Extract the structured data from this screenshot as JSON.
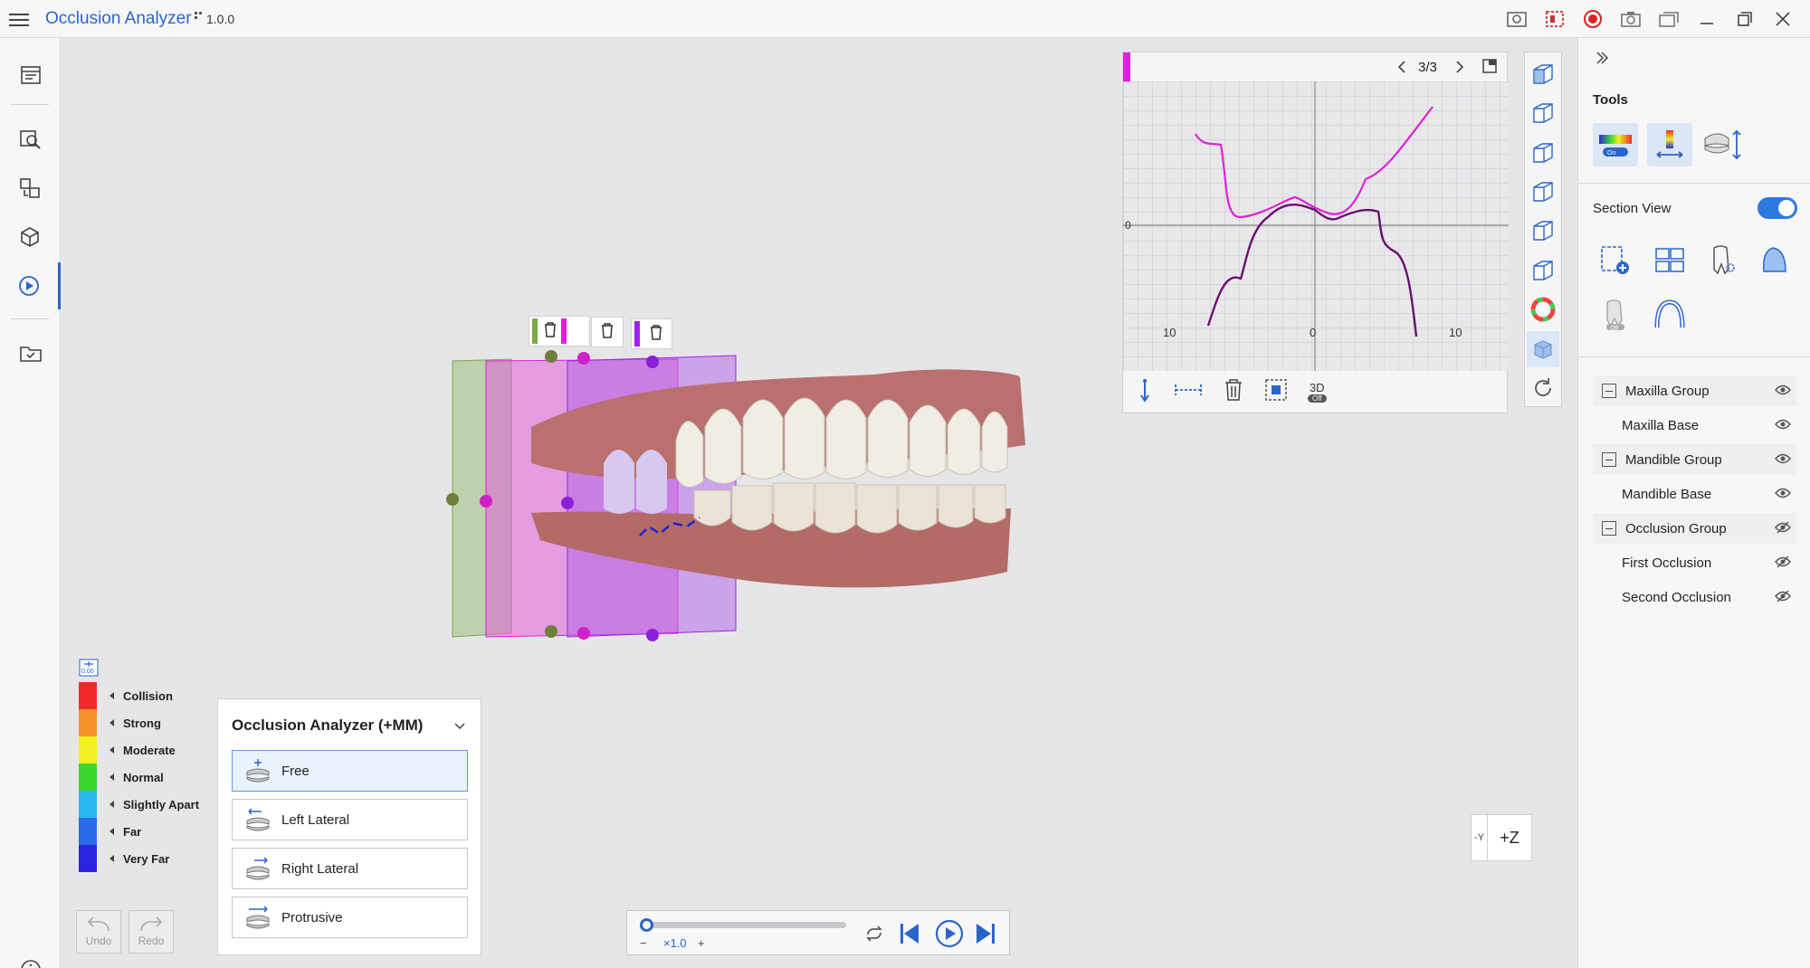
{
  "app": {
    "title": "Occlusion Analyzer",
    "version": "1.0.0"
  },
  "window_controls": [
    "capture-icon",
    "crop-record-icon",
    "record-icon",
    "camera-icon",
    "screens-icon",
    "minimize-icon",
    "restore-icon",
    "close-icon"
  ],
  "left_nav": [
    "report-icon",
    "inspect-icon",
    "align-icon",
    "model-icon",
    "play-icon",
    "checklist-icon"
  ],
  "graph": {
    "page": "3/3",
    "tick_left": "10",
    "tick_center": "0",
    "tick_right": "10",
    "zero_label": "0",
    "toggle_3d": "3D",
    "toggle_3d_state": "Off",
    "marker_color": "#e020d8"
  },
  "right_panel": {
    "tools_title": "Tools",
    "section_view_title": "Section View",
    "section_view_on": true,
    "tool_on_label": "On",
    "section_off_label": "Off",
    "tree": [
      {
        "label": "Maxilla Group",
        "group": true,
        "visible": true
      },
      {
        "label": "Maxilla Base",
        "group": false,
        "visible": true
      },
      {
        "label": "Mandible Group",
        "group": true,
        "visible": true
      },
      {
        "label": "Mandible Base",
        "group": false,
        "visible": true
      },
      {
        "label": "Occlusion Group",
        "group": true,
        "visible": false
      },
      {
        "label": "First Occlusion",
        "group": false,
        "visible": false
      },
      {
        "label": "Second Occlusion",
        "group": false,
        "visible": false
      }
    ]
  },
  "legend": {
    "scale_value": "0.00",
    "items": [
      {
        "label": "Collision",
        "color": "#f02a2a"
      },
      {
        "label": "Strong",
        "color": "#f7922a"
      },
      {
        "label": "Moderate",
        "color": "#f2f01e"
      },
      {
        "label": "Normal",
        "color": "#3cd62e"
      },
      {
        "label": "Slightly Apart",
        "color": "#2ab8ef"
      },
      {
        "label": "Far",
        "color": "#2a6ae8"
      },
      {
        "label": "Very Far",
        "color": "#2a26e0"
      }
    ]
  },
  "motion_panel": {
    "title": "Occlusion Analyzer (+MM)",
    "buttons": [
      "Free",
      "Left Lateral",
      "Right Lateral",
      "Protrusive"
    ],
    "selected": "Free"
  },
  "undo_label": "Undo",
  "redo_label": "Redo",
  "playback": {
    "speed": "×1.0",
    "minus": "−",
    "plus": "+"
  },
  "axis": {
    "left": "-Y",
    "main": "+Z"
  },
  "plane_colors": {
    "green": "#7aa84a",
    "magenta": "#e020d8",
    "purple": "#a020e8"
  }
}
